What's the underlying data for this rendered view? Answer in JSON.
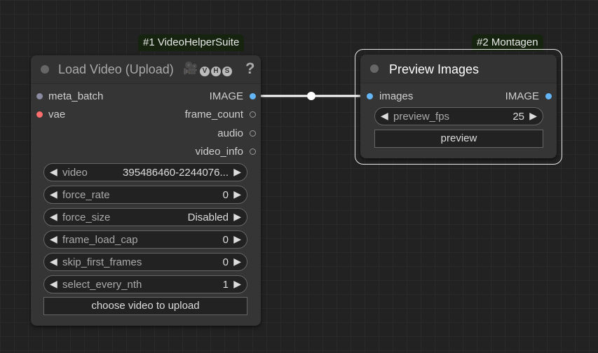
{
  "node1": {
    "badge": "#1 VideoHelperSuite",
    "title": "Load Video (Upload)",
    "title_icons": "🎥",
    "vhs_letters": [
      "V",
      "H",
      "S"
    ],
    "help": "?",
    "inputs": [
      {
        "label": "meta_batch",
        "color": "#8a8aa0"
      },
      {
        "label": "vae",
        "color": "#ff6e6e"
      }
    ],
    "outputs": [
      {
        "label": "IMAGE",
        "color": "#64b5f6"
      },
      {
        "label": "frame_count",
        "color": "#9a9a9a"
      },
      {
        "label": "audio",
        "color": "#9a9a9a"
      },
      {
        "label": "video_info",
        "color": "#9a9a9a"
      }
    ],
    "widgets": [
      {
        "name": "video",
        "value": "395486460-2244076..."
      },
      {
        "name": "force_rate",
        "value": "0"
      },
      {
        "name": "force_size",
        "value": "Disabled"
      },
      {
        "name": "frame_load_cap",
        "value": "0"
      },
      {
        "name": "skip_first_frames",
        "value": "0"
      },
      {
        "name": "select_every_nth",
        "value": "1"
      }
    ],
    "upload_button": "choose video to upload"
  },
  "node2": {
    "badge": "#2 Montagen",
    "title": "Preview Images",
    "input": {
      "label": "images",
      "color": "#64b5f6"
    },
    "output": {
      "label": "IMAGE",
      "color": "#64b5f6"
    },
    "widget": {
      "name": "preview_fps",
      "value": "25"
    },
    "button": "preview"
  },
  "arrows": {
    "left": "◀",
    "right": "▶"
  },
  "link_color": "#ffffff"
}
